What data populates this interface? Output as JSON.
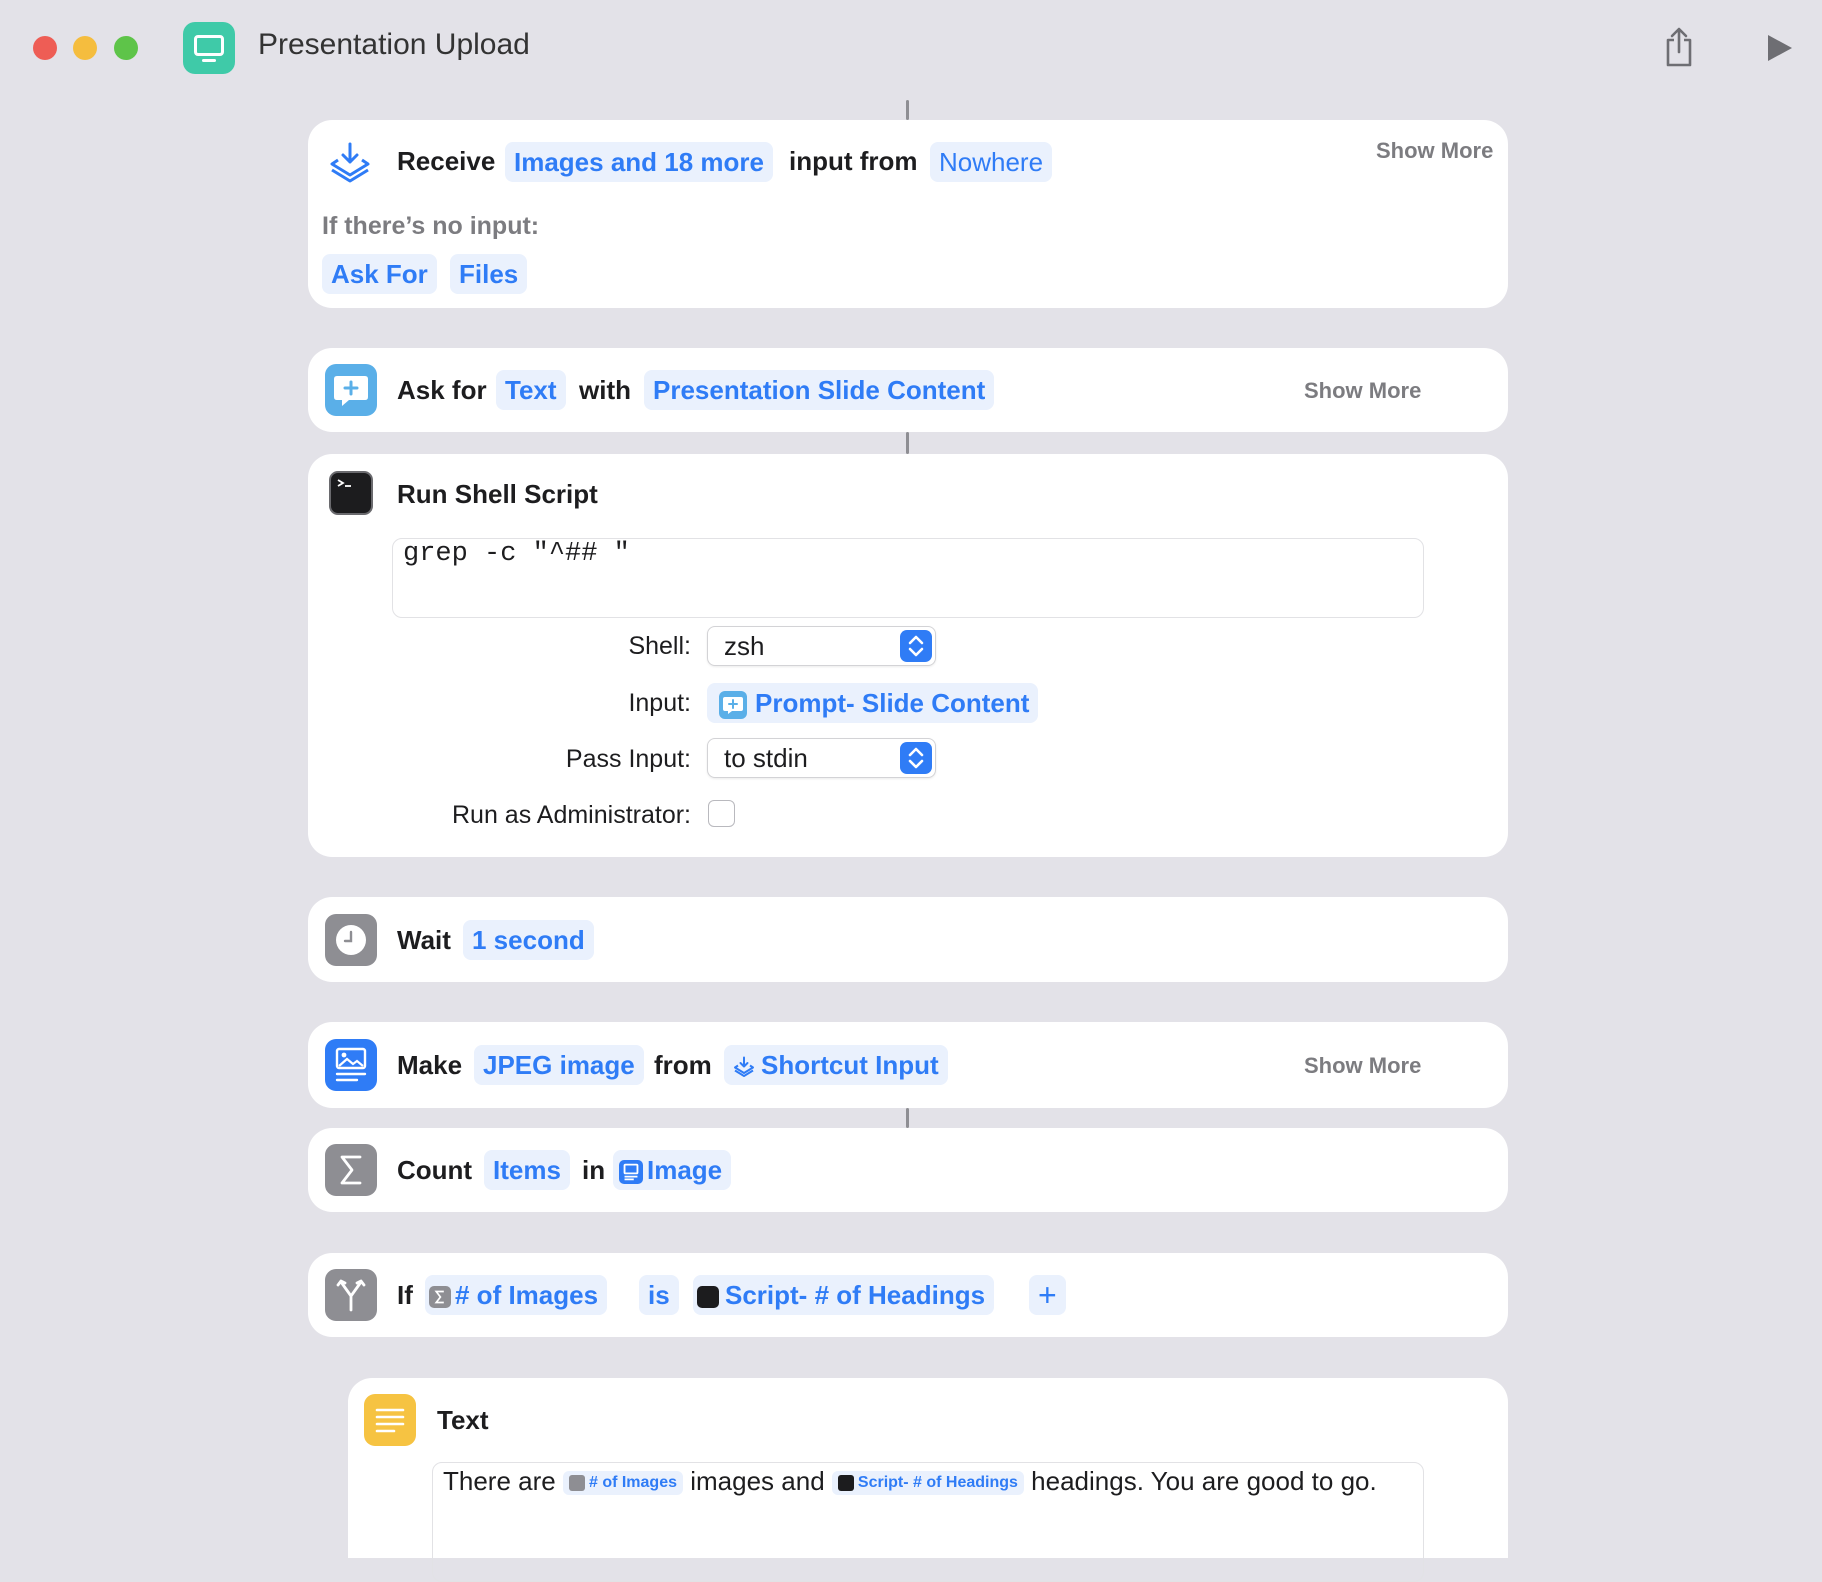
{
  "window": {
    "title": "Presentation Upload",
    "colors": {
      "close": "#ee5d55",
      "minimize": "#f5bd3e",
      "maximize": "#5ec449",
      "accent": "#2f7cf6",
      "app_icon": "#3fcaa8"
    },
    "icons": [
      "share-icon",
      "play-icon"
    ]
  },
  "receive": {
    "verb": "Receive",
    "types": "Images and 18 more",
    "mid": "input from",
    "source": "Nowhere",
    "show_more": "Show More",
    "no_input_label": "If there’s no input:",
    "fallback_action": "Ask For",
    "fallback_type": "Files"
  },
  "ask": {
    "verb": "Ask for",
    "type": "Text",
    "mid": "with",
    "prompt": "Presentation Slide Content",
    "show_more": "Show More"
  },
  "shell": {
    "title": "Run Shell Script",
    "script": "grep -c \"^## \"",
    "shell_label": "Shell:",
    "shell_value": "zsh",
    "input_label": "Input:",
    "input_value": "Prompt- Slide Content",
    "pass_label": "Pass Input:",
    "pass_value": "to stdin",
    "admin_label": "Run as Administrator:",
    "admin_checked": false
  },
  "wait": {
    "verb": "Wait",
    "duration": "1 second"
  },
  "make": {
    "verb": "Make",
    "format": "JPEG image",
    "mid": "from",
    "source": "Shortcut Input",
    "show_more": "Show More"
  },
  "count": {
    "verb": "Count",
    "what": "Items",
    "mid": "in",
    "source": "Image"
  },
  "if_block": {
    "verb": "If",
    "lhs": "# of Images",
    "op": "is",
    "rhs": "Script- # of Headings",
    "add": "+"
  },
  "text_action": {
    "title": "Text",
    "part1": "There are",
    "var1": "# of Images",
    "part2": "images and",
    "var2": "Script- # of Headings",
    "part3": "headings. You are good to",
    "part4": "go."
  }
}
